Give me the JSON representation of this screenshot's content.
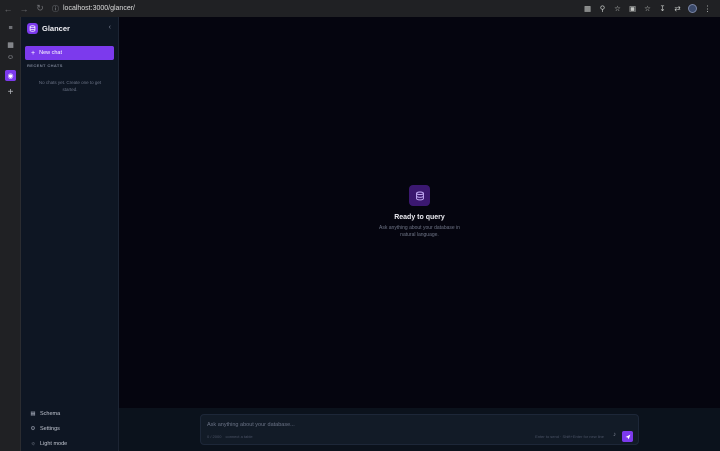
{
  "browser": {
    "url": "localhost:3000/glancer/"
  },
  "app": {
    "name": "Glancer",
    "new_chat_label": "New chat",
    "recent_chats_label": "RECENT CHATS",
    "empty_chats_message": "No chats yet. Create one to get started."
  },
  "bottom_nav": [
    {
      "label": "Schema",
      "icon": "table-icon"
    },
    {
      "label": "Settings",
      "icon": "gear-icon"
    },
    {
      "label": "Light mode",
      "icon": "sun-icon"
    }
  ],
  "main": {
    "title": "Ready to query",
    "subtitle": "Ask anything about your database in natural language."
  },
  "composer": {
    "placeholder": "Ask anything about your database...",
    "meta_left_1": "0 / 2000",
    "meta_left_2": "connect a table",
    "hint": "Enter to send · Shift+Enter for new line"
  },
  "colors": {
    "accent": "#7c3aed",
    "sidebar_bg": "#0e1623",
    "main_bg": "#05050f"
  }
}
